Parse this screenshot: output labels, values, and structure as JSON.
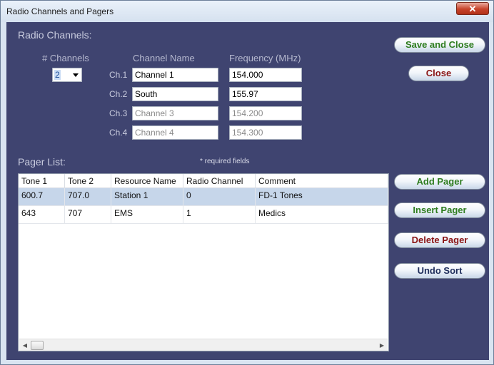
{
  "window": {
    "title": "Radio Channels and Pagers",
    "close_glyph": "✕"
  },
  "radio": {
    "section_label": "Radio Channels:",
    "channels_label": "# Channels",
    "channels_value": "2",
    "name_header": "Channel Name",
    "freq_header": "Frequency (MHz)",
    "rows": [
      {
        "label": "Ch.1",
        "name": "Channel 1",
        "freq": "154.000"
      },
      {
        "label": "Ch.2",
        "name": "South",
        "freq": "155.97"
      },
      {
        "label": "Ch.3",
        "name": "Channel 3",
        "freq": "154.200"
      },
      {
        "label": "Ch.4",
        "name": "Channel 4",
        "freq": "154.300"
      }
    ]
  },
  "pager": {
    "section_label": "Pager List:",
    "required_note": "* required fields",
    "columns": [
      "Tone 1",
      "Tone 2",
      "Resource Name",
      "Radio Channel",
      "Comment"
    ],
    "rows": [
      [
        "600.7",
        "707.0",
        "Station 1",
        "0",
        "FD-1 Tones"
      ],
      [
        "643",
        "707",
        "EMS",
        "1",
        "Medics"
      ]
    ]
  },
  "buttons": {
    "save_close": "Save and Close",
    "close": "Close",
    "add_pager": "Add Pager",
    "insert_pager": "Insert Pager",
    "delete_pager": "Delete Pager",
    "undo_sort": "Undo Sort"
  },
  "colors": {
    "panel_bg": "#3f4470",
    "green_text": "#2e7d1f",
    "red_text": "#8b1414",
    "navy_text": "#1d2c5a"
  }
}
